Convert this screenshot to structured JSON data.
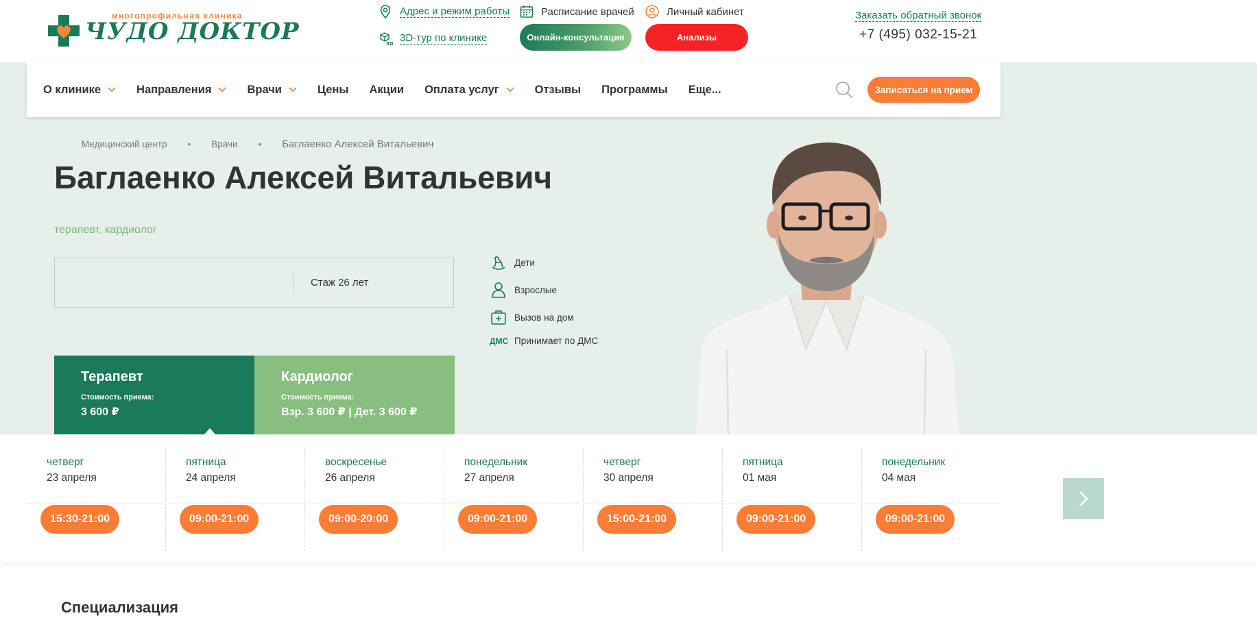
{
  "header": {
    "logo": {
      "tagline": "многопрофильная клиника",
      "name": "ЧУДО ДОКТОР"
    },
    "links": {
      "address": "Адрес и режим работы",
      "schedule": "Расписание врачей",
      "account": "Личный кабинет",
      "tour": "3D-тур по клинике"
    },
    "buttons": {
      "online": "Онлайн-консультация",
      "tests": "Анализы"
    },
    "callback": "Заказать обратный звонок",
    "phone": "+7 (495) 032-15-21"
  },
  "nav": {
    "items": [
      {
        "label": "О клинике",
        "dropdown": true
      },
      {
        "label": "Направления",
        "dropdown": true
      },
      {
        "label": "Врачи",
        "dropdown": true
      },
      {
        "label": "Цены",
        "dropdown": false
      },
      {
        "label": "Акции",
        "dropdown": false
      },
      {
        "label": "Оплата услуг",
        "dropdown": true
      },
      {
        "label": "Отзывы",
        "dropdown": false
      },
      {
        "label": "Программы",
        "dropdown": false
      },
      {
        "label": "Еще...",
        "dropdown": false
      }
    ],
    "cta": "Записаться на прием"
  },
  "breadcrumb": [
    "Медицинский центр",
    "Врачи",
    "Баглаенко Алексей Витальевич"
  ],
  "doctor": {
    "name": "Баглаенко Алексей Витальевич",
    "specialties": [
      "терапевт",
      "кардиолог"
    ],
    "experience": "Стаж 26 лет",
    "features": [
      {
        "icon": "rocking-horse-icon",
        "label": "Дети"
      },
      {
        "icon": "adult-person-icon",
        "label": "Взрослые"
      },
      {
        "icon": "medical-kit-icon",
        "label": "Вызов на дом"
      },
      {
        "icon": "dms-badge",
        "badge": "ДМС",
        "label": "Принимает по ДМС"
      }
    ],
    "prices": [
      {
        "title": "Терапевт",
        "label": "Стоимость приема:",
        "value": "3 600 ₽",
        "active": true
      },
      {
        "title": "Кардиолог",
        "label": "Стоимость приема:",
        "value": "Взр. 3 600 ₽ | Дет. 3 600 ₽",
        "active": false
      }
    ]
  },
  "schedule": [
    {
      "weekday": "четверг",
      "date": "23 апреля",
      "slot": "15:30-21:00"
    },
    {
      "weekday": "пятница",
      "date": "24 апреля",
      "slot": "09:00-21:00"
    },
    {
      "weekday": "воскресенье",
      "date": "26 апреля",
      "slot": "09:00-20:00"
    },
    {
      "weekday": "понедельник",
      "date": "27 апреля",
      "slot": "09:00-21:00"
    },
    {
      "weekday": "четверг",
      "date": "30 апреля",
      "slot": "15:00-21:00"
    },
    {
      "weekday": "пятница",
      "date": "01 мая",
      "slot": "09:00-21:00"
    },
    {
      "weekday": "понедельник",
      "date": "04 мая",
      "slot": "09:00-21:00"
    }
  ],
  "section": {
    "title": "Специализация"
  },
  "colors": {
    "brand_green": "#1a7a56",
    "light_green": "#86bf7e",
    "orange": "#f97d35",
    "red": "#f52323",
    "hero_bg": "#e6efe9"
  }
}
